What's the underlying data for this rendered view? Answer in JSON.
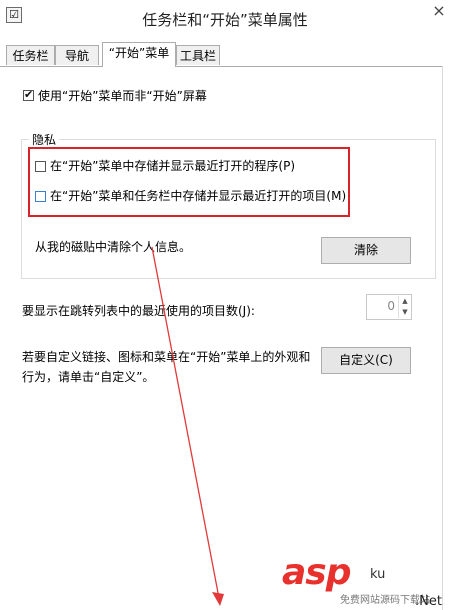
{
  "window": {
    "title": "任务栏和“开始”菜单属性",
    "icon_glyph": "☑",
    "close_glyph": "×"
  },
  "tabs": [
    {
      "label": "任务栏",
      "active": false
    },
    {
      "label": "导航",
      "active": false
    },
    {
      "label": "“开始”菜单",
      "active": true
    },
    {
      "label": "工具栏",
      "active": false
    }
  ],
  "start_screen_checkbox": {
    "label": "使用“开始”菜单而非“开始”屏幕",
    "checked": true
  },
  "privacy": {
    "group_title": "隐私",
    "store_programs": {
      "label": "在“开始”菜单中存储并显示最近打开的程序(P)",
      "checked": false
    },
    "store_items": {
      "label": "在“开始”菜单和任务栏中存储并显示最近打开的项目(M)",
      "checked": false
    },
    "clear_text": "从我的磁贴中清除个人信息。",
    "clear_button": "清除"
  },
  "jump_list": {
    "label": "要显示在跳转列表中的最近使用的项目数(J):",
    "value": "0",
    "up_glyph": "▲",
    "down_glyph": "▼"
  },
  "customize": {
    "text_line1": "若要自定义链接、图标和菜单在“开始”菜单上的外观和",
    "text_line2": "行为，请单击“自定义”。",
    "button": "自定义(C)"
  },
  "annotation": {
    "highlight_color": "#d9232a",
    "arrow_color": "#e23a3a"
  },
  "watermark": {
    "brand": "asp",
    "brand2": "ku",
    "sub": "免费网站源码下载站",
    "net": ".Net"
  }
}
